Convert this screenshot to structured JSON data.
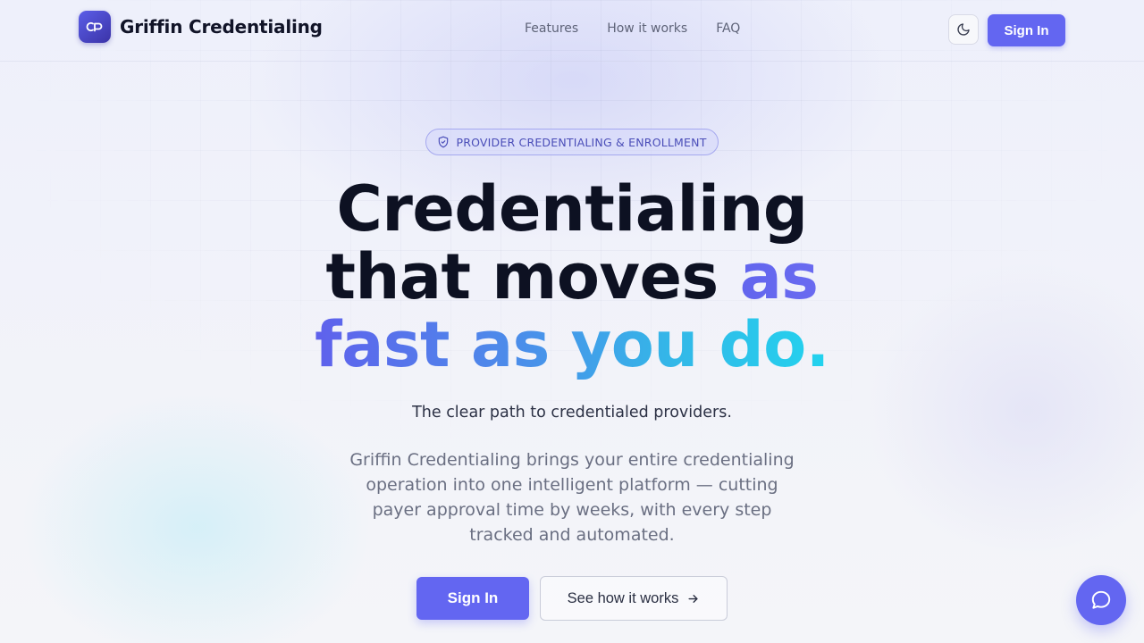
{
  "colors": {
    "accent": "#6366f1",
    "heading": "#0d1122",
    "gradient_start": "#5f61ec",
    "gradient_end": "#22d3ee"
  },
  "header": {
    "brand_name": "Griffin Credentialing",
    "logo_icon": "credential-logo-icon",
    "nav": [
      {
        "label": "Features"
      },
      {
        "label": "How it works"
      },
      {
        "label": "FAQ"
      }
    ],
    "theme_toggle_icon": "moon-icon",
    "signin_label": "Sign In"
  },
  "hero": {
    "badge": {
      "icon": "shield-check-icon",
      "label": "PROVIDER CREDENTIALING & ENROLLMENT"
    },
    "headline": {
      "line1": "Credentialing",
      "line2_plain": "that moves",
      "line2_gradient": "as",
      "line3_gradient": "fast as you do."
    },
    "tagline": "The clear path to credentialed providers.",
    "description": "Griffin Credentialing brings your entire credentialing operation into one intelligent platform — cutting payer approval time by weeks, with every step tracked and automated.",
    "cta_primary": "Sign In",
    "cta_secondary": "See how it works",
    "cta_secondary_icon": "arrow-right-icon"
  },
  "chat": {
    "icon": "chat-bubble-icon"
  }
}
